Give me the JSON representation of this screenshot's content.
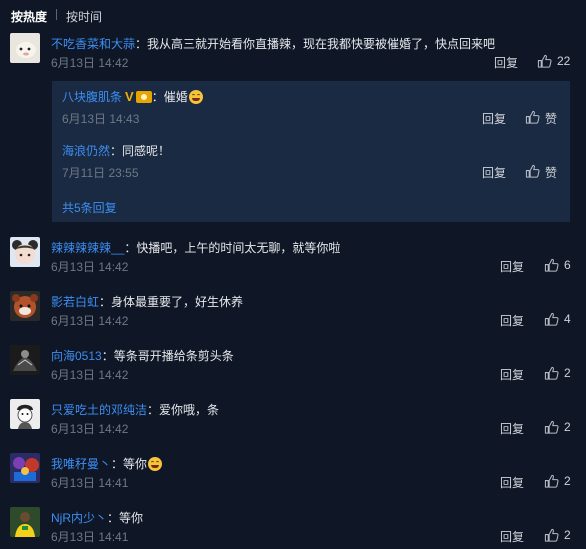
{
  "sort": {
    "hot_label": "按热度",
    "time_label": "按时间"
  },
  "reply_label": "回复",
  "colors": {
    "username": "#3d8ef2",
    "background": "#0f1726",
    "sub_background": "#1a2a42",
    "badge": "#f2b000"
  },
  "comments": [
    {
      "user": "不吃香菜和大蒜",
      "text": "我从高三就开始看你直播辣，现在我都快要被催婚了，快点回来吧",
      "time": "6月13日 14:42",
      "likes": "22"
    },
    {
      "user": "辣辣辣辣辣__",
      "text": "快播吧，上午的时间太无聊，就等你啦",
      "time": "6月13日 14:42",
      "likes": "6"
    },
    {
      "user": "影若白虹",
      "text": "身体最重要了，好生休养",
      "time": "6月13日 14:42",
      "likes": "4"
    },
    {
      "user": "向海0513",
      "text": "等条哥开播给条剪头条",
      "time": "6月13日 14:42",
      "likes": "2"
    },
    {
      "user": "只爱吃土的邓纯洁",
      "text": "爱你哦，条",
      "time": "6月13日 14:42",
      "likes": "2"
    },
    {
      "user": "我唯秄曼丶",
      "text": "等你",
      "time": "6月13日 14:41",
      "likes": "2"
    },
    {
      "user": "NjR内少丶",
      "text": "等你",
      "time": "6月13日 14:41",
      "likes": "2"
    }
  ],
  "sub_replies": [
    {
      "user": "八块腹肌条",
      "badge": "V",
      "text": "催婚",
      "time": "6月13日 14:43",
      "likes": "赞"
    },
    {
      "user": "海浪仍然",
      "text": "同感呢！",
      "time": "7月11日 23:55",
      "likes": "赞"
    }
  ],
  "more_replies": "共5条回复"
}
